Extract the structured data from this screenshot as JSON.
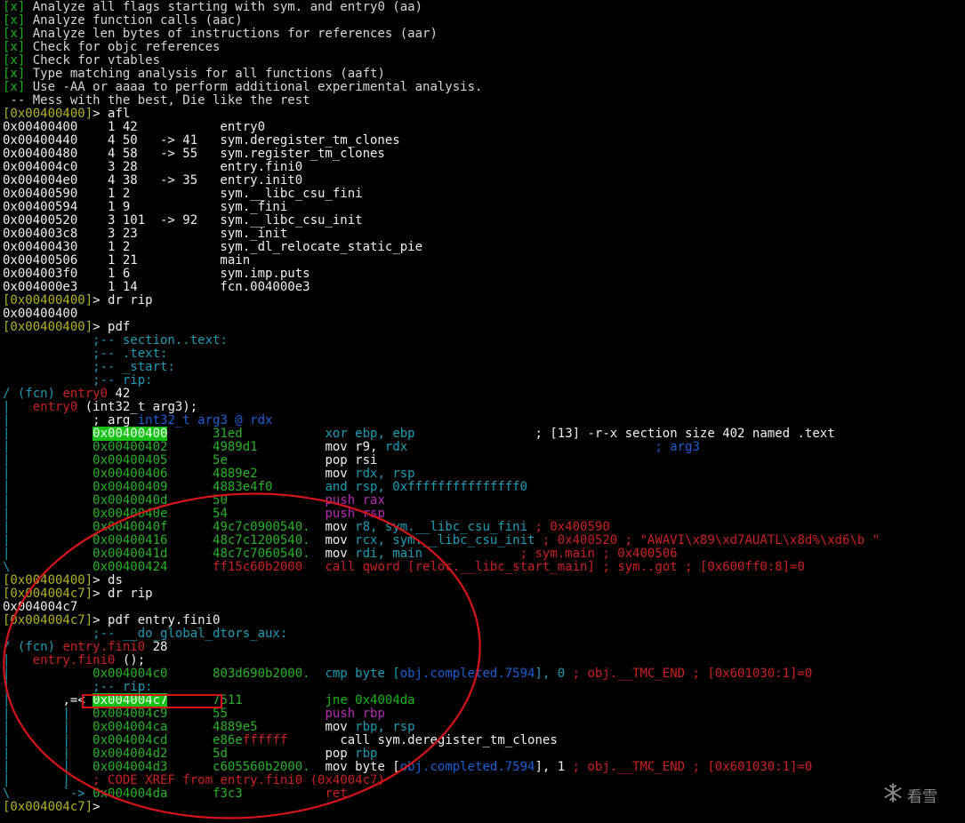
{
  "terminal": {
    "lines": [
      [
        [
          "[x]",
          "c-green"
        ],
        [
          " Analyze all flags starting with sym. and entry0 (aa)",
          "c-gray"
        ]
      ],
      [
        [
          "[x]",
          "c-green"
        ],
        [
          " Analyze function calls (aac)",
          "c-gray"
        ]
      ],
      [
        [
          "[x]",
          "c-green"
        ],
        [
          " Analyze len bytes of instructions for references (aar)",
          "c-gray"
        ]
      ],
      [
        [
          "[x]",
          "c-green"
        ],
        [
          " Check for objc references",
          "c-gray"
        ]
      ],
      [
        [
          "[x]",
          "c-green"
        ],
        [
          " Check for vtables",
          "c-gray"
        ]
      ],
      [
        [
          "[x]",
          "c-green"
        ],
        [
          " Type matching analysis for all functions (aaft)",
          "c-gray"
        ]
      ],
      [
        [
          "[x]",
          "c-green"
        ],
        [
          " Use -AA or aaaa to perform additional experimental analysis.",
          "c-gray"
        ]
      ],
      [
        [
          " -- Mess with the best, Die like the rest",
          "c-gray"
        ]
      ],
      [
        [
          "[0x00400400]",
          "c-olive"
        ],
        [
          "> afl",
          "c-white"
        ]
      ],
      [
        [
          "0x00400400    1 42           entry0",
          "c-white"
        ]
      ],
      [
        [
          "0x00400440    4 50   -> 41   sym.deregister_tm_clones",
          "c-white"
        ]
      ],
      [
        [
          "0x00400480    4 58   -> 55   sym.register_tm_clones",
          "c-white"
        ]
      ],
      [
        [
          "0x004004c0    3 28           entry.fini0",
          "c-white"
        ]
      ],
      [
        [
          "0x004004e0    4 38   -> 35   entry.init0",
          "c-white"
        ]
      ],
      [
        [
          "0x00400590    1 2            sym.__libc_csu_fini",
          "c-white"
        ]
      ],
      [
        [
          "0x00400594    1 9            sym._fini",
          "c-white"
        ]
      ],
      [
        [
          "0x00400520    3 101  -> 92   sym.__libc_csu_init",
          "c-white"
        ]
      ],
      [
        [
          "0x004003c8    3 23           sym._init",
          "c-white"
        ]
      ],
      [
        [
          "0x00400430    1 2            sym._dl_relocate_static_pie",
          "c-white"
        ]
      ],
      [
        [
          "0x00400506    1 21           main",
          "c-white"
        ]
      ],
      [
        [
          "0x004003f0    1 6            sym.imp.puts",
          "c-white"
        ]
      ],
      [
        [
          "0x004000e3    1 14           fcn.004000e3",
          "c-white"
        ]
      ],
      [
        [
          "[0x00400400]",
          "c-olive"
        ],
        [
          "> dr rip",
          "c-white"
        ]
      ],
      [
        [
          "0x00400400",
          "c-white"
        ]
      ],
      [
        [
          "[0x00400400]",
          "c-olive"
        ],
        [
          "> pdf",
          "c-white"
        ]
      ],
      [
        [
          "            ;-- section..text:",
          "c-cyan"
        ]
      ],
      [
        [
          "            ;-- .text:",
          "c-cyan"
        ]
      ],
      [
        [
          "            ;-- _start:",
          "c-cyan"
        ]
      ],
      [
        [
          "            ;-- rip:",
          "c-cyan"
        ]
      ],
      [
        [
          "/ (fcn) ",
          "c-cyan"
        ],
        [
          "entry0",
          "c-red"
        ],
        [
          " 42",
          "c-white"
        ]
      ],
      [
        [
          "|   ",
          "c-cyan"
        ],
        [
          "entry0",
          "c-red"
        ],
        [
          " (int32_t arg3);",
          "c-white"
        ]
      ],
      [
        [
          "|           ",
          "c-cyan"
        ],
        [
          "; arg ",
          "c-white"
        ],
        [
          "int32_t arg3 @ rdx",
          "c-blue"
        ]
      ],
      [
        [
          "|           ",
          "c-cyan"
        ],
        [
          "0x00400400",
          "c-hl"
        ],
        [
          "      31ed           ",
          "c-addr"
        ],
        [
          "xor ebp, ebp",
          "c-cyan"
        ],
        [
          "                ; [13] -r-x section size 402 named .text",
          "c-white"
        ]
      ],
      [
        [
          "|           ",
          "c-cyan"
        ],
        [
          "0x00400402      4989d1         ",
          "c-addr"
        ],
        [
          "mov r9, ",
          "c-white"
        ],
        [
          "rdx",
          "c-cyan"
        ],
        [
          "                                 ; arg3",
          "c-blue"
        ]
      ],
      [
        [
          "|           ",
          "c-cyan"
        ],
        [
          "0x00400405      5e             ",
          "c-addr"
        ],
        [
          "pop rsi",
          "c-white"
        ]
      ],
      [
        [
          "|           ",
          "c-cyan"
        ],
        [
          "0x00400406      4889e2         ",
          "c-addr"
        ],
        [
          "mov ",
          "c-white"
        ],
        [
          "rdx, rsp",
          "c-cyan"
        ]
      ],
      [
        [
          "|           ",
          "c-cyan"
        ],
        [
          "0x00400409      4883e4f0       ",
          "c-addr"
        ],
        [
          "and rsp, 0xfffffffffffffff0",
          "c-cyan"
        ]
      ],
      [
        [
          "|           ",
          "c-cyan"
        ],
        [
          "0x0040040d      50             ",
          "c-addr"
        ],
        [
          "push rax",
          "c-purple"
        ]
      ],
      [
        [
          "|           ",
          "c-cyan"
        ],
        [
          "0x0040040e      54             ",
          "c-addr"
        ],
        [
          "push rsp",
          "c-purple"
        ]
      ],
      [
        [
          "|           ",
          "c-cyan"
        ],
        [
          "0x0040040f      49c7c0900540.  ",
          "c-addr"
        ],
        [
          "mov ",
          "c-white"
        ],
        [
          "r8, sym.__libc_csu_fini",
          "c-cyan"
        ],
        [
          " ; 0x400590",
          "c-red"
        ]
      ],
      [
        [
          "|           ",
          "c-cyan"
        ],
        [
          "0x00400416      48c7c1200540.  ",
          "c-addr"
        ],
        [
          "mov ",
          "c-white"
        ],
        [
          "rcx, sym.__libc_csu_init",
          "c-cyan"
        ],
        [
          " ; 0x400520 ; \"AWAVI\\x89\\xd7AUATL\\x8d%\\xd6\\b \"",
          "c-red"
        ]
      ],
      [
        [
          "|           ",
          "c-cyan"
        ],
        [
          "0x0040041d      48c7c7060540.  ",
          "c-addr"
        ],
        [
          "mov ",
          "c-white"
        ],
        [
          "rdi, main",
          "c-cyan"
        ],
        [
          "             ; sym.main ; 0x400506",
          "c-red"
        ]
      ],
      [
        [
          "\\           ",
          "c-cyan"
        ],
        [
          "0x00400424      ",
          "c-addr"
        ],
        [
          "ff15c60b2000",
          "c-red"
        ],
        [
          "   ",
          "c-addr"
        ],
        [
          "call qword [reloc.__libc_start_main] ; sym..got ; [0x600ff0:8]=0",
          "c-red"
        ]
      ],
      [
        [
          "[0x00400400]",
          "c-olive"
        ],
        [
          "> ds",
          "c-white"
        ]
      ],
      [
        [
          "[0x004004c7]",
          "c-olive"
        ],
        [
          "> dr rip",
          "c-white"
        ]
      ],
      [
        [
          "0x004004c7",
          "c-white"
        ]
      ],
      [
        [
          "[0x004004c7]",
          "c-olive"
        ],
        [
          "> pdf entry.fini0",
          "c-white"
        ]
      ],
      [
        [
          "            ;-- __do_global_dtors_aux:",
          "c-cyan"
        ]
      ],
      [
        [
          "/ (fcn) ",
          "c-cyan"
        ],
        [
          "entry.fini0",
          "c-red"
        ],
        [
          " 28",
          "c-white"
        ]
      ],
      [
        [
          "|   ",
          "c-cyan"
        ],
        [
          "entry.fini0",
          "c-red"
        ],
        [
          " ();",
          "c-white"
        ]
      ],
      [
        [
          "|           ",
          "c-cyan"
        ],
        [
          "0x004004c0      803d690b2000.  ",
          "c-addr"
        ],
        [
          "cmp byte [",
          "c-cyan"
        ],
        [
          "obj.completed.7594",
          "c-blue"
        ],
        [
          "], 0",
          "c-cyan"
        ],
        [
          " ; obj.__TMC_END ; [0x601030:1]=0",
          "c-red"
        ]
      ],
      [
        [
          "|           ",
          "c-cyan"
        ],
        [
          ";-- rip:",
          "c-cyan"
        ]
      ],
      [
        [
          "|       ",
          "c-cyan"
        ],
        [
          ",=< ",
          "c-white"
        ],
        [
          "0x004004c7",
          "c-hl"
        ],
        [
          "      7511           ",
          "c-addr"
        ],
        [
          "jne 0x4004da",
          "c-green"
        ]
      ],
      [
        [
          "|       ",
          "c-cyan"
        ],
        [
          "|   ",
          "c-cyan"
        ],
        [
          "0x004004c9      55             ",
          "c-addr"
        ],
        [
          "push rbp",
          "c-purple"
        ]
      ],
      [
        [
          "|       ",
          "c-cyan"
        ],
        [
          "|   ",
          "c-cyan"
        ],
        [
          "0x004004ca      4889e5         ",
          "c-addr"
        ],
        [
          "mov ",
          "c-white"
        ],
        [
          "rbp, rsp",
          "c-cyan"
        ]
      ],
      [
        [
          "|       ",
          "c-cyan"
        ],
        [
          "|   ",
          "c-cyan"
        ],
        [
          "0x004004cd      ",
          "c-addr"
        ],
        [
          "e86e",
          "c-addr"
        ],
        [
          "ffffff",
          "c-red"
        ],
        [
          "       ",
          "c-addr"
        ],
        [
          "call sym.deregister_tm_clones",
          "c-white"
        ]
      ],
      [
        [
          "|       ",
          "c-cyan"
        ],
        [
          "|   ",
          "c-cyan"
        ],
        [
          "0x004004d2      5d             ",
          "c-addr"
        ],
        [
          "pop ",
          "c-white"
        ],
        [
          "rbp",
          "c-cyan"
        ]
      ],
      [
        [
          "|       ",
          "c-cyan"
        ],
        [
          "|   ",
          "c-cyan"
        ],
        [
          "0x004004d3      c605560b2000.  ",
          "c-addr"
        ],
        [
          "mov byte [",
          "c-white"
        ],
        [
          "obj.completed.7594",
          "c-blue"
        ],
        [
          "], 1",
          "c-white"
        ],
        [
          " ; obj.__TMC_END ; [0x601030:1]=0",
          "c-red"
        ]
      ],
      [
        [
          "|       ",
          "c-cyan"
        ],
        [
          "|   ",
          "c-cyan"
        ],
        [
          "; CODE XREF from entry.fini0 (0x4004c7)",
          "c-red"
        ]
      ],
      [
        [
          "\\       ",
          "c-cyan"
        ],
        [
          "`-> ",
          "c-cyan"
        ],
        [
          "0x004004da      f3c3           ",
          "c-addr"
        ],
        [
          "ret",
          "c-red"
        ]
      ],
      [
        [
          "[0x004004c7]",
          "c-olive"
        ],
        [
          "> ",
          "c-white"
        ]
      ]
    ]
  },
  "watermark": {
    "text": "看雪",
    "icon": "snowflake-icon"
  },
  "colors": {
    "annotation_red": "#d7141a"
  }
}
